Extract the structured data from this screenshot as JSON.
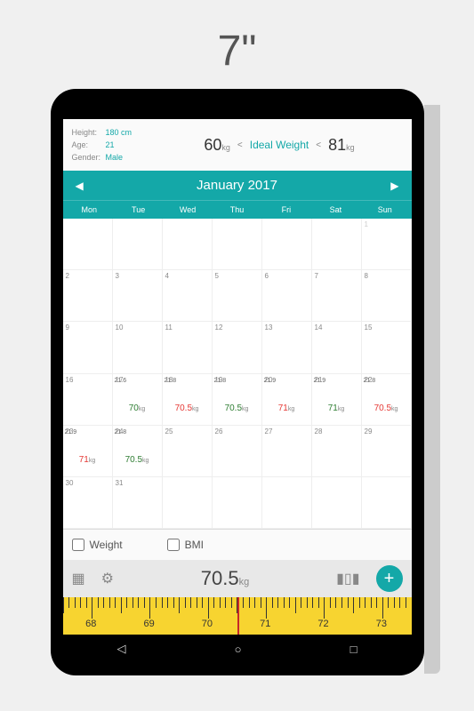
{
  "page_title": "7\"",
  "info": {
    "height_label": "Height:",
    "height_value": "180 cm",
    "age_label": "Age:",
    "age_value": "21",
    "gender_label": "Gender:",
    "gender_value": "Male",
    "range_low": "60",
    "range_low_unit": "kg",
    "ideal_label": "Ideal Weight",
    "range_high": "81",
    "range_high_unit": "kg",
    "lt": "<",
    "lt2": "<"
  },
  "month": "January 2017",
  "dow": [
    "Mon",
    "Tue",
    "Wed",
    "Thu",
    "Fri",
    "Sat",
    "Sun"
  ],
  "cells": [
    {
      "n": "",
      "d": true
    },
    {
      "n": "",
      "d": true
    },
    {
      "n": "",
      "d": true
    },
    {
      "n": "",
      "d": true
    },
    {
      "n": "",
      "d": true
    },
    {
      "n": "",
      "d": true
    },
    {
      "n": "1",
      "d": true
    },
    {
      "n": "2"
    },
    {
      "n": "3"
    },
    {
      "n": "4"
    },
    {
      "n": "5"
    },
    {
      "n": "6"
    },
    {
      "n": "7"
    },
    {
      "n": "8"
    },
    {
      "n": "9"
    },
    {
      "n": "10"
    },
    {
      "n": "11"
    },
    {
      "n": "12"
    },
    {
      "n": "13"
    },
    {
      "n": "14"
    },
    {
      "n": "15"
    },
    {
      "n": "16"
    },
    {
      "n": "17",
      "bmi": "21.6",
      "wt": "70",
      "wc": "green"
    },
    {
      "n": "18",
      "bmi": "21.8",
      "wt": "70.5",
      "wc": "red"
    },
    {
      "n": "19",
      "bmi": "21.8",
      "wt": "70.5",
      "wc": "green"
    },
    {
      "n": "20",
      "bmi": "21.9",
      "wt": "71",
      "wc": "red"
    },
    {
      "n": "21",
      "bmi": "21.9",
      "wt": "71",
      "wc": "green"
    },
    {
      "n": "22",
      "bmi": "21.8",
      "wt": "70.5",
      "wc": "red"
    },
    {
      "n": "23",
      "bmi": "21.9",
      "wt": "71",
      "wc": "red"
    },
    {
      "n": "24",
      "bmi": "21.8",
      "wt": "70.5",
      "wc": "green"
    },
    {
      "n": "25"
    },
    {
      "n": "26"
    },
    {
      "n": "27"
    },
    {
      "n": "28"
    },
    {
      "n": "29"
    },
    {
      "n": "30"
    },
    {
      "n": "31"
    },
    {
      "n": "",
      "d": true
    },
    {
      "n": "",
      "d": true
    },
    {
      "n": "",
      "d": true
    },
    {
      "n": "",
      "d": true
    },
    {
      "n": "",
      "d": true
    }
  ],
  "unit": "kg",
  "toggles": {
    "weight": "Weight",
    "bmi": "BMI"
  },
  "current_weight": "70.5",
  "ruler_labels": [
    "68",
    "69",
    "70",
    "71",
    "72",
    "73"
  ]
}
